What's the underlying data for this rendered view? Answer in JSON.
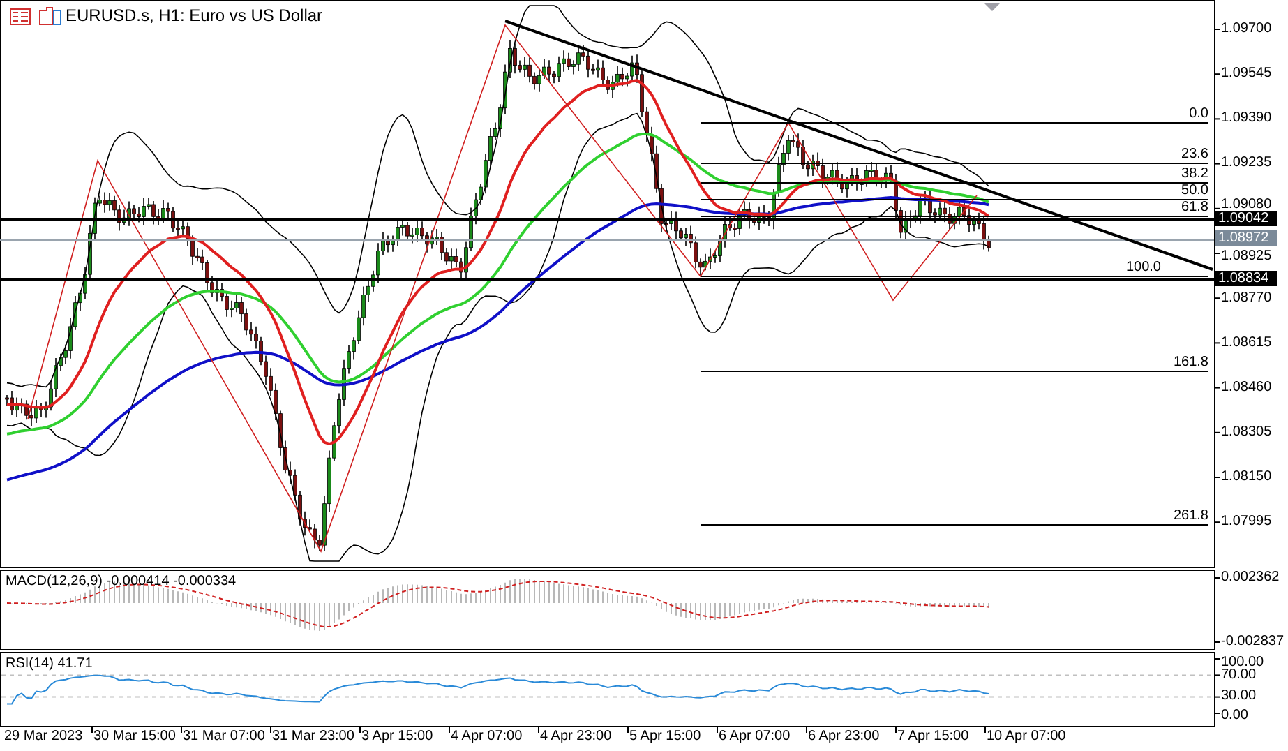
{
  "chart": {
    "title": "EURUSD.s, H1:  Euro vs US Dollar",
    "price_axis": [
      "1.09700",
      "1.09545",
      "1.09390",
      "1.09235",
      "1.09080",
      "1.08925",
      "1.08770",
      "1.08615",
      "1.08460",
      "1.08305",
      "1.08150",
      "1.07995"
    ],
    "fib_levels": [
      {
        "label": "0.0"
      },
      {
        "label": "23.6"
      },
      {
        "label": "38.2"
      },
      {
        "label": "50.0"
      },
      {
        "label": "61.8"
      },
      {
        "label": "100.0"
      },
      {
        "label": "161.8"
      },
      {
        "label": "261.8"
      }
    ],
    "price_tags": [
      {
        "label": "1.09042",
        "kind": "line"
      },
      {
        "label": "1.08972",
        "kind": "bid"
      },
      {
        "label": "1.08834",
        "kind": "line"
      }
    ],
    "time_axis": [
      "29 Mar 2023",
      "30 Mar 15:00",
      "31 Mar 07:00",
      "31 Mar 23:00",
      "3 Apr 15:00",
      "4 Apr 07:00",
      "4 Apr 23:00",
      "5 Apr 15:00",
      "6 Apr 07:00",
      "6 Apr 23:00",
      "7 Apr 15:00",
      "10 Apr 07:00"
    ]
  },
  "macd": {
    "label": "MACD(12,26,9) -0.000414 -0.000334",
    "axis": [
      "0.002362",
      "-0.002837"
    ]
  },
  "rsi": {
    "label": "RSI(14) 41.71",
    "axis": [
      "100.00",
      "70.00",
      "30.00",
      "0.00"
    ]
  }
}
